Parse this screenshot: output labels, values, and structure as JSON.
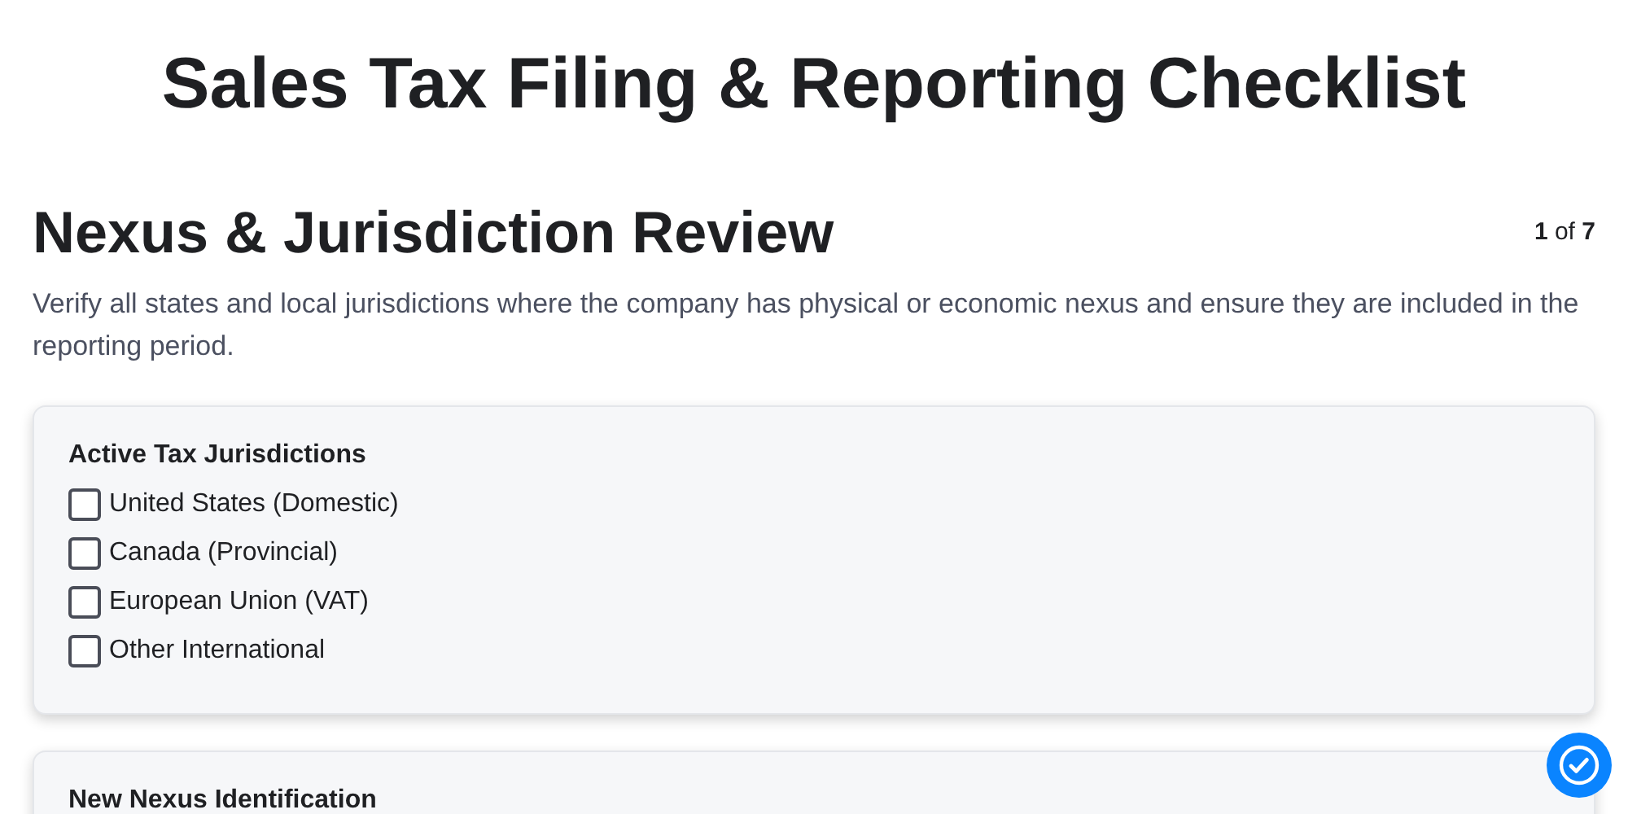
{
  "title": "Sales Tax Filing & Reporting Checklist",
  "section": {
    "heading": "Nexus & Jurisdiction Review",
    "progress": "**1** of **7**",
    "description": "Verify all states and local jurisdictions where the company has physical or economic nexus and ensure they are included in the reporting period."
  },
  "cards": [
    {
      "title": "Active Tax Jurisdictions",
      "options": [
        {
          "label": "United States (Domestic)",
          "checked": false
        },
        {
          "label": "Canada (Provincial)",
          "checked": false
        },
        {
          "label": "European Union (VAT)",
          "checked": false
        },
        {
          "label": "Other International",
          "checked": false
        }
      ]
    },
    {
      "title": "New Nexus Identification"
    }
  ]
}
